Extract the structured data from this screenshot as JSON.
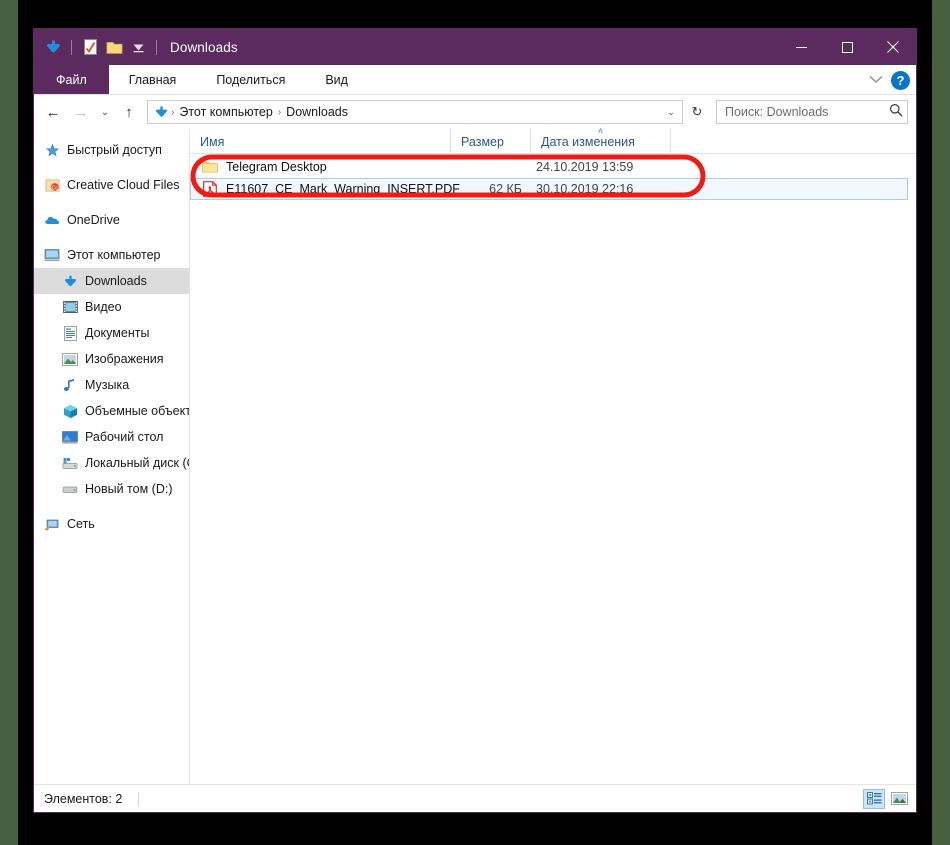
{
  "colors": {
    "titlebar": "#5b2a5e",
    "accent_blue": "#2b5797",
    "annotation_red": "#ee1c17",
    "selection_blue": "#a8cdf0",
    "desktop_green": "#46603f"
  },
  "titlebar": {
    "title": "Downloads",
    "quick_access": [
      {
        "name": "downloads-folder-icon",
        "label": "Downloads"
      },
      {
        "name": "properties-icon",
        "label": "Свойства"
      },
      {
        "name": "new-folder-icon",
        "label": "Создать папку"
      },
      {
        "name": "customize-qat-chevron-icon",
        "label": "Настроить панель быстрого доступа"
      }
    ],
    "controls": {
      "minimize": "—",
      "maximize": "☐",
      "close": "✕"
    }
  },
  "ribbon": {
    "tabs": [
      {
        "label": "Файл",
        "active_file": true
      },
      {
        "label": "Главная",
        "active_file": false
      },
      {
        "label": "Поделиться",
        "active_file": false
      },
      {
        "label": "Вид",
        "active_file": false
      }
    ],
    "collapse_icon": "⌄",
    "help_label": "?"
  },
  "addressbar": {
    "back_icon": "←",
    "forward_icon": "→",
    "history_icon": "⌄",
    "up_icon": "↑",
    "breadcrumb": [
      {
        "label": "Этот компьютер"
      },
      {
        "label": "Downloads"
      }
    ],
    "breadcrumb_sep": "›",
    "dropdown_icon": "⌄",
    "refresh_icon": "↻"
  },
  "search": {
    "placeholder": "Поиск: Downloads",
    "value": "",
    "icon": "⌕"
  },
  "sidebar": {
    "items": [
      {
        "label": "Быстрый доступ",
        "icon": "quick-access-star-icon",
        "indent": false,
        "selected": false
      },
      {
        "label": "Creative Cloud Files",
        "icon": "creative-cloud-icon",
        "indent": false,
        "selected": false
      },
      {
        "label": "OneDrive",
        "icon": "onedrive-cloud-icon",
        "indent": false,
        "selected": false
      },
      {
        "label": "Этот компьютер",
        "icon": "this-pc-monitor-icon",
        "indent": false,
        "selected": false
      },
      {
        "label": "Downloads",
        "icon": "downloads-arrow-icon",
        "indent": true,
        "selected": true
      },
      {
        "label": "Видео",
        "icon": "videos-icon",
        "indent": true,
        "selected": false
      },
      {
        "label": "Документы",
        "icon": "documents-icon",
        "indent": true,
        "selected": false
      },
      {
        "label": "Изображения",
        "icon": "pictures-icon",
        "indent": true,
        "selected": false
      },
      {
        "label": "Музыка",
        "icon": "music-note-icon",
        "indent": true,
        "selected": false
      },
      {
        "label": "Объемные объект",
        "icon": "3d-objects-icon",
        "indent": true,
        "selected": false
      },
      {
        "label": "Рабочий стол",
        "icon": "desktop-icon",
        "indent": true,
        "selected": false
      },
      {
        "label": "Локальный диск (C",
        "icon": "local-disk-icon",
        "indent": true,
        "selected": false
      },
      {
        "label": "Новый том (D:)",
        "icon": "drive-icon",
        "indent": true,
        "selected": false
      },
      {
        "label": "Сеть",
        "icon": "network-icon",
        "indent": false,
        "selected": false
      }
    ]
  },
  "columns": {
    "name": "Имя",
    "size": "Размер",
    "date": "Дата изменения",
    "sort_caret": "˄"
  },
  "files": [
    {
      "name": "Telegram Desktop",
      "size": "",
      "date": "24.10.2019 13:59",
      "icon": "folder-icon",
      "selected": false
    },
    {
      "name": "E11607_CE_Mark_Warning_INSERT.PDF",
      "size": "62 КБ",
      "date": "30.10.2019 22:16",
      "icon": "pdf-file-icon",
      "selected": true
    }
  ],
  "statusbar": {
    "items_count": "Элементов: 2",
    "views": [
      {
        "name": "details-view-button",
        "active": true
      },
      {
        "name": "large-icons-view-button",
        "active": false
      }
    ]
  }
}
